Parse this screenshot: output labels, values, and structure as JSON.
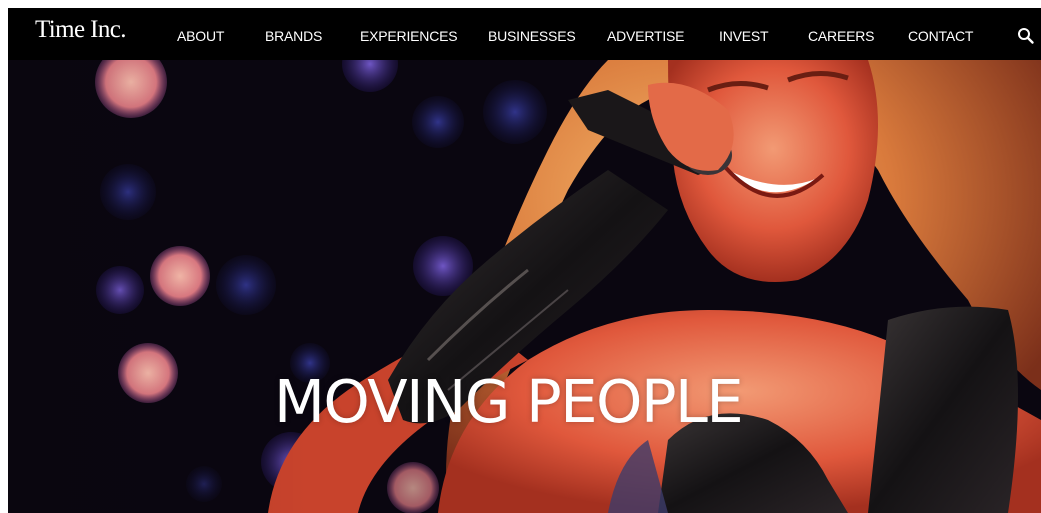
{
  "header": {
    "logo_text": "Time Inc.",
    "nav": [
      {
        "label": "ABOUT"
      },
      {
        "label": "BRANDS"
      },
      {
        "label": "EXPERIENCES"
      },
      {
        "label": "BUSINESSES"
      },
      {
        "label": "ADVERTISE"
      },
      {
        "label": "INVEST"
      },
      {
        "label": "CAREERS"
      },
      {
        "label": "CONTACT"
      }
    ],
    "search_icon": "search-icon"
  },
  "hero": {
    "headline": "MOVING PEOPLE",
    "image_subject": "performer singing into microphone on stage"
  },
  "colors": {
    "nav_background": "#000000",
    "nav_text": "#ffffff",
    "headline_text": "#ffffff",
    "hero_warm_tone": "#e2533c",
    "bokeh_purple": "#5a3fb0",
    "bokeh_peach": "#f08a8a"
  }
}
